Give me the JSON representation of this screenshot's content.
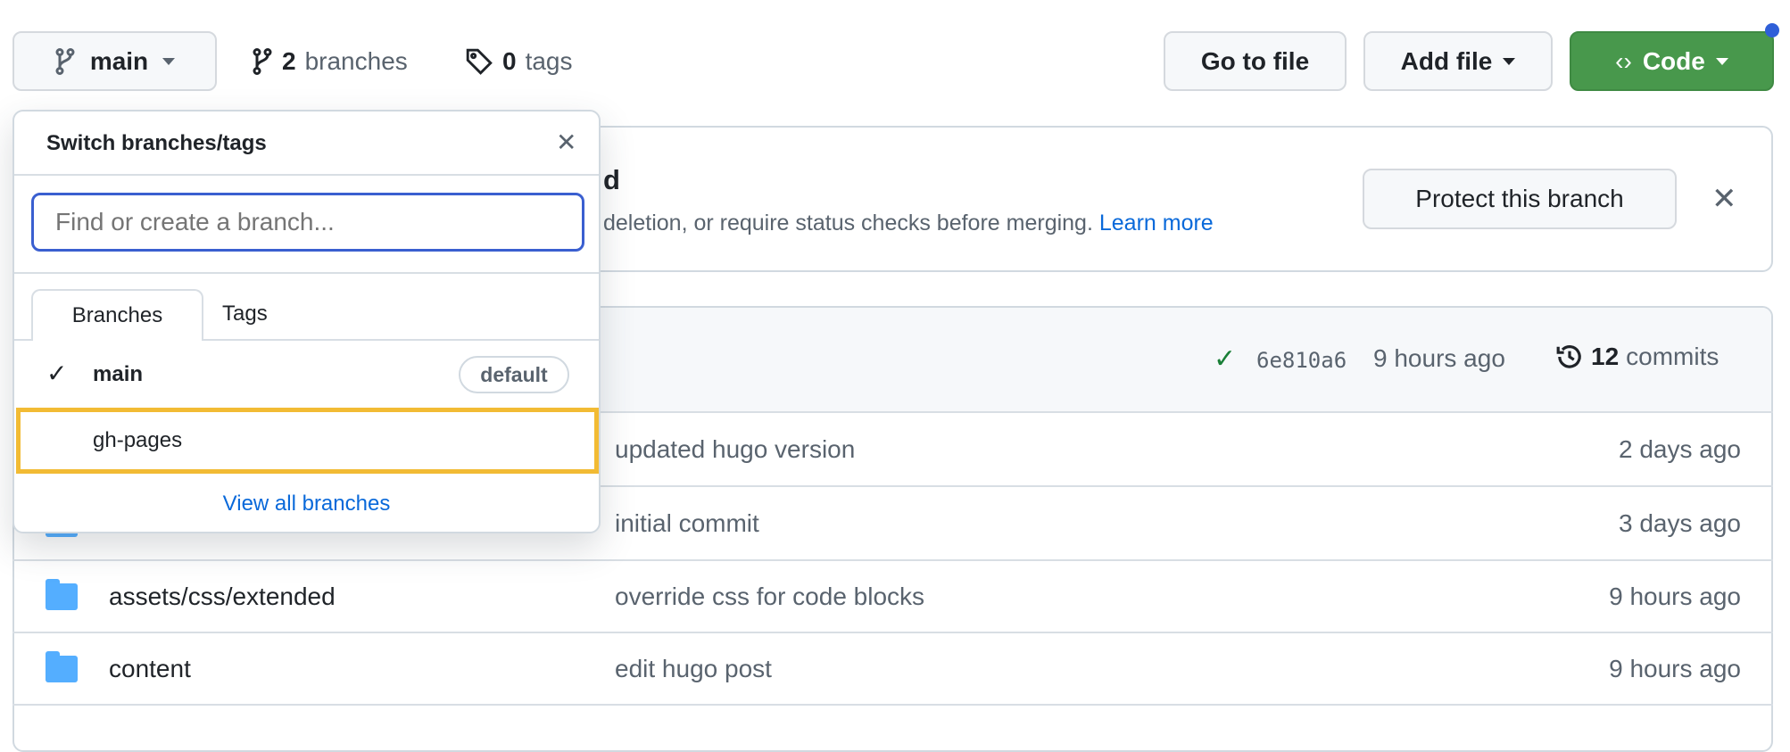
{
  "toolbar": {
    "branch": "main",
    "branches_count": "2",
    "branches_label": "branches",
    "tags_count": "0",
    "tags_label": "tags",
    "go_to_file": "Go to file",
    "add_file": "Add file",
    "code": "Code"
  },
  "banner": {
    "title_fragment": "d",
    "text_fragment": "deletion, or require status checks before merging.",
    "learn_more": "Learn more",
    "protect_button": "Protect this branch"
  },
  "commit_bar": {
    "hash": "6e810a6",
    "time": "9 hours ago",
    "commits_count": "12",
    "commits_label": "commits"
  },
  "files": [
    {
      "name": "",
      "message": "updated hugo version",
      "date": "2 days ago"
    },
    {
      "name": "",
      "message": "initial commit",
      "date": "3 days ago"
    },
    {
      "name": "assets/css/extended",
      "message": "override css for code blocks",
      "date": "9 hours ago"
    },
    {
      "name": "content",
      "message": "edit hugo post",
      "date": "9 hours ago"
    }
  ],
  "dropdown": {
    "title": "Switch branches/tags",
    "search_placeholder": "Find or create a branch...",
    "tabs": [
      "Branches",
      "Tags"
    ],
    "branches": [
      {
        "name": "main",
        "badge": "default",
        "selected": true
      },
      {
        "name": "gh-pages",
        "highlighted": true
      }
    ],
    "view_all": "View all branches"
  },
  "colors": {
    "accent_green": "#48984c",
    "link_blue": "#0969da",
    "focus_blue": "#3a5fd0",
    "highlight": "#f2bb34",
    "folder": "#54aeff",
    "notification_dot": "#2f5fd8"
  }
}
